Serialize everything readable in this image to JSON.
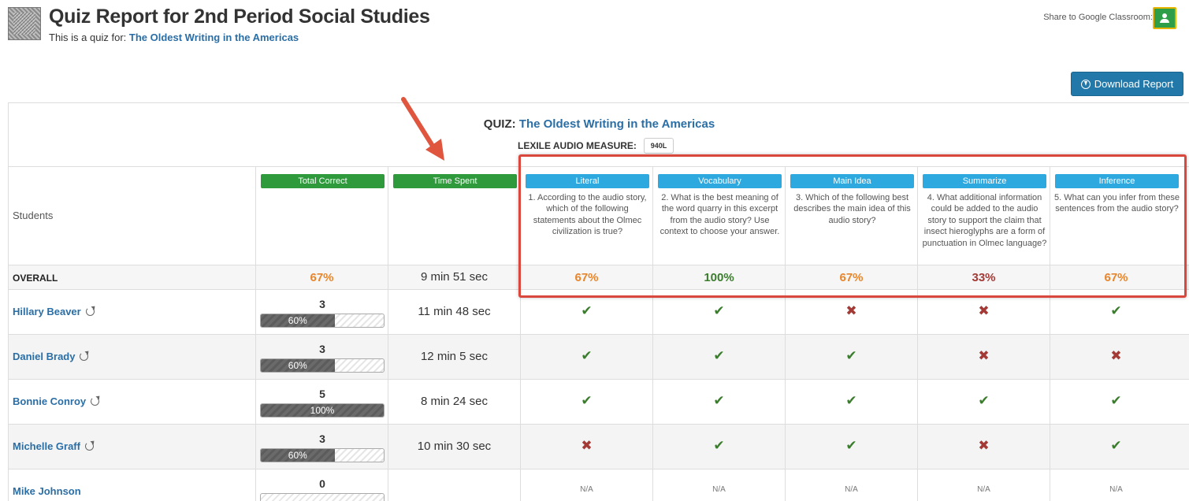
{
  "header": {
    "title": "Quiz Report for 2nd Period Social Studies",
    "subtitle_prefix": "This is a quiz for:",
    "subtitle_link": "The Oldest Writing in the Americas",
    "share_label": "Share to Google Classroom:",
    "download_label": "Download Report"
  },
  "quiz": {
    "label": "QUIZ:",
    "title": "The Oldest Writing in the Americas",
    "lexile_label": "LEXILE AUDIO MEASURE:",
    "lexile_value": "940L"
  },
  "columns": {
    "students": "Students",
    "total_correct": "Total Correct",
    "time_spent": "Time Spent"
  },
  "questions": [
    {
      "category": "Literal",
      "text": "1. According to the audio story, which of the following statements about the Olmec civilization is true?"
    },
    {
      "category": "Vocabulary",
      "text": "2. What is the best meaning of the word quarry in this excerpt from the audio story? Use context to choose your answer."
    },
    {
      "category": "Main Idea",
      "text": "3. Which of the following best describes the main idea of this audio story?"
    },
    {
      "category": "Summarize",
      "text": "4. What additional information could be added to the audio story to support the claim that insect hieroglyphs are a form of punctuation in Olmec language?"
    },
    {
      "category": "Inference",
      "text": "5. What can you infer from these sentences from the audio story?"
    }
  ],
  "overall": {
    "label": "OVERALL",
    "total_correct": "67%",
    "time_spent": "9 min 51 sec",
    "questions": [
      "67%",
      "100%",
      "67%",
      "33%",
      "67%"
    ]
  },
  "students": [
    {
      "name": "Hillary Beaver",
      "score": "3",
      "percent": "60%",
      "progress": 0.6,
      "time": "11 min 48 sec",
      "results": [
        "check",
        "check",
        "cross",
        "cross",
        "check"
      ]
    },
    {
      "name": "Daniel Brady",
      "score": "3",
      "percent": "60%",
      "progress": 0.6,
      "time": "12 min 5 sec",
      "results": [
        "check",
        "check",
        "check",
        "cross",
        "cross"
      ]
    },
    {
      "name": "Bonnie Conroy",
      "score": "5",
      "percent": "100%",
      "progress": 1.0,
      "time": "8 min 24 sec",
      "results": [
        "check",
        "check",
        "check",
        "check",
        "check"
      ]
    },
    {
      "name": "Michelle Graff",
      "score": "3",
      "percent": "60%",
      "progress": 0.6,
      "time": "10 min 30 sec",
      "results": [
        "cross",
        "check",
        "check",
        "cross",
        "check"
      ]
    },
    {
      "name": "Mike Johnson",
      "score": "0",
      "percent": "",
      "progress": 0,
      "time": "",
      "results": [
        "N/A",
        "N/A",
        "N/A",
        "N/A",
        "N/A"
      ]
    }
  ],
  "symbols": {
    "check": "✔",
    "cross": "✖"
  },
  "colors": {
    "accent_blue": "#2278a8",
    "pill_green": "#2e9a3b",
    "pill_blue": "#2ea9df",
    "highlight_red": "#d9473d"
  }
}
